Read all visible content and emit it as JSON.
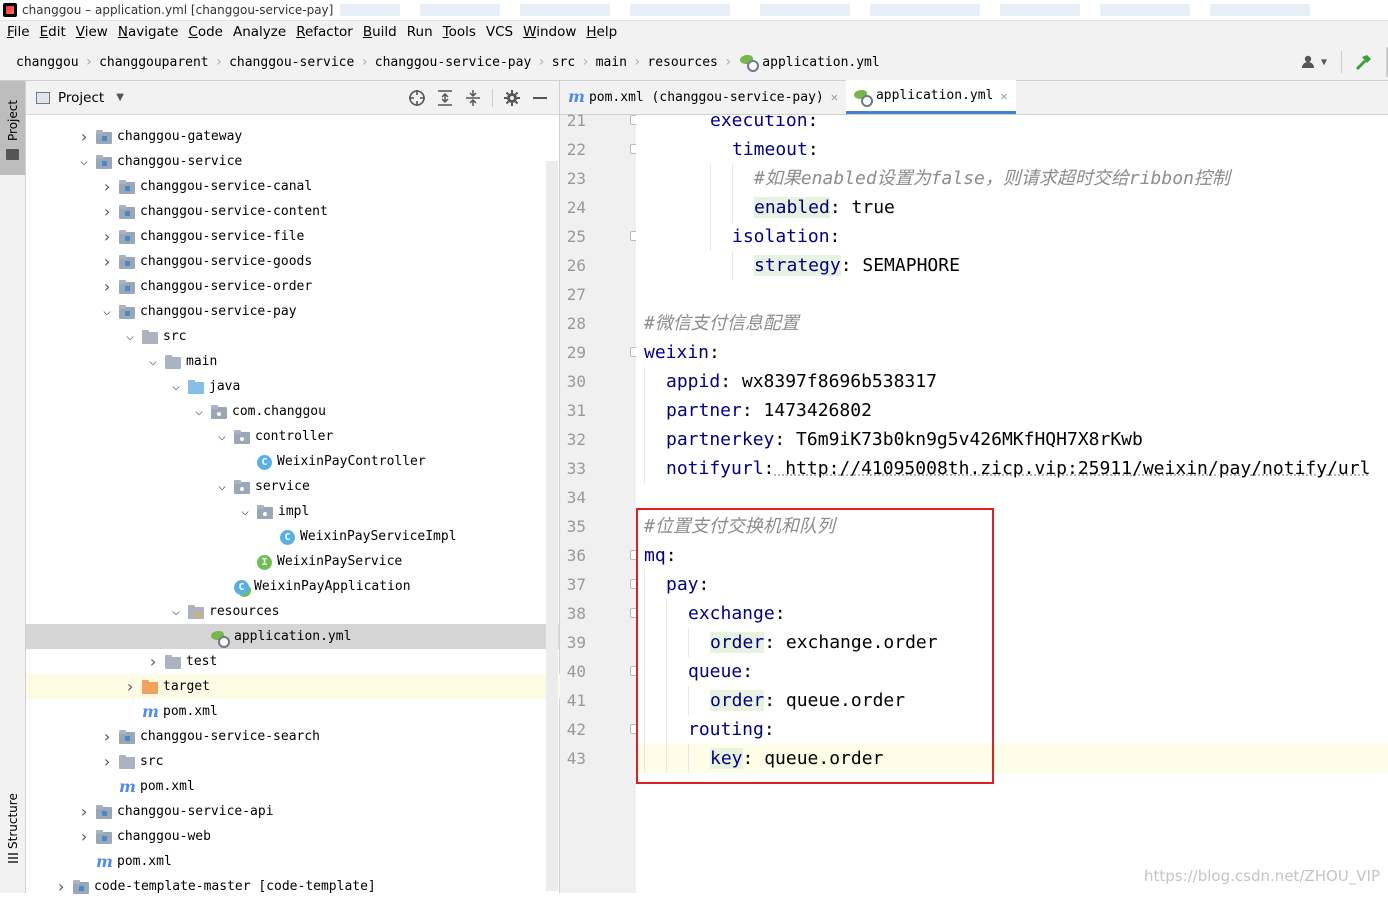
{
  "window": {
    "title": "changgou – application.yml [changgou-service-pay]"
  },
  "menu": [
    {
      "label": "File",
      "u": "F",
      "rest": "ile"
    },
    {
      "label": "Edit",
      "u": "E",
      "rest": "dit"
    },
    {
      "label": "View",
      "u": "V",
      "rest": "iew"
    },
    {
      "label": "Navigate",
      "u": "N",
      "rest": "avigate"
    },
    {
      "label": "Code",
      "u": "C",
      "rest": "ode"
    },
    {
      "label": "Analyze",
      "u": "",
      "rest": "Analyze"
    },
    {
      "label": "Refactor",
      "u": "R",
      "rest": "efactor"
    },
    {
      "label": "Build",
      "u": "B",
      "rest": "uild"
    },
    {
      "label": "Run",
      "u": "",
      "rest": "Run"
    },
    {
      "label": "Tools",
      "u": "T",
      "rest": "ools"
    },
    {
      "label": "VCS",
      "u": "",
      "rest": "VCS"
    },
    {
      "label": "Window",
      "u": "W",
      "rest": "indow"
    },
    {
      "label": "Help",
      "u": "H",
      "rest": "elp"
    }
  ],
  "breadcrumbs": [
    "changgou",
    "changgouparent",
    "changgou-service",
    "changgou-service-pay",
    "src",
    "main",
    "resources",
    "application.yml"
  ],
  "project_panel": {
    "title": "Project",
    "tree": [
      {
        "label": "changgou-gateway",
        "depth": 2,
        "arrow": "›",
        "icon": "module-folder",
        "bold": false
      },
      {
        "label": "changgou-service",
        "depth": 2,
        "arrow": "⌄",
        "icon": "module-folder"
      },
      {
        "label": "changgou-service-canal",
        "depth": 3,
        "arrow": "›",
        "icon": "module-folder"
      },
      {
        "label": "changgou-service-content",
        "depth": 3,
        "arrow": "›",
        "icon": "module-folder"
      },
      {
        "label": "changgou-service-file",
        "depth": 3,
        "arrow": "›",
        "icon": "module-folder"
      },
      {
        "label": "changgou-service-goods",
        "depth": 3,
        "arrow": "›",
        "icon": "module-folder"
      },
      {
        "label": "changgou-service-order",
        "depth": 3,
        "arrow": "›",
        "icon": "module-folder"
      },
      {
        "label": "changgou-service-pay",
        "depth": 3,
        "arrow": "⌄",
        "icon": "module-folder"
      },
      {
        "label": "src",
        "depth": 4,
        "arrow": "⌄",
        "icon": "folder"
      },
      {
        "label": "main",
        "depth": 5,
        "arrow": "⌄",
        "icon": "folder"
      },
      {
        "label": "java",
        "depth": 6,
        "arrow": "⌄",
        "icon": "source-folder"
      },
      {
        "label": "com.changgou",
        "depth": 7,
        "arrow": "⌄",
        "icon": "package"
      },
      {
        "label": "controller",
        "depth": 8,
        "arrow": "⌄",
        "icon": "package"
      },
      {
        "label": "WeixinPayController",
        "depth": 9,
        "arrow": "",
        "icon": "class"
      },
      {
        "label": "service",
        "depth": 8,
        "arrow": "⌄",
        "icon": "package"
      },
      {
        "label": "impl",
        "depth": 9,
        "arrow": "⌄",
        "icon": "package"
      },
      {
        "label": "WeixinPayServiceImpl",
        "depth": 10,
        "arrow": "",
        "icon": "class"
      },
      {
        "label": "WeixinPayService",
        "depth": 9,
        "arrow": "",
        "icon": "interface"
      },
      {
        "label": "WeixinPayApplication",
        "depth": 8,
        "arrow": "",
        "icon": "spring-class"
      },
      {
        "label": "resources",
        "depth": 6,
        "arrow": "⌄",
        "icon": "resources-folder"
      },
      {
        "label": "application.yml",
        "depth": 7,
        "arrow": "",
        "icon": "yml-file",
        "selected": true
      },
      {
        "label": "test",
        "depth": 5,
        "arrow": "›",
        "icon": "folder"
      },
      {
        "label": "target",
        "depth": 4,
        "arrow": "›",
        "icon": "excluded-folder",
        "highlight": true
      },
      {
        "label": "pom.xml",
        "depth": 4,
        "arrow": "",
        "icon": "maven-file"
      },
      {
        "label": "changgou-service-search",
        "depth": 3,
        "arrow": "›",
        "icon": "module-folder"
      },
      {
        "label": "src",
        "depth": 3,
        "arrow": "›",
        "icon": "folder"
      },
      {
        "label": "pom.xml",
        "depth": 3,
        "arrow": "",
        "icon": "maven-file"
      },
      {
        "label": "changgou-service-api",
        "depth": 2,
        "arrow": "›",
        "icon": "module-folder"
      },
      {
        "label": "changgou-web",
        "depth": 2,
        "arrow": "›",
        "icon": "module-folder"
      },
      {
        "label": "pom.xml",
        "depth": 2,
        "arrow": "",
        "icon": "maven-file"
      },
      {
        "label": "code-template-master [code-template]",
        "depth": 1,
        "arrow": "›",
        "icon": "module-folder"
      }
    ]
  },
  "side_tabs": {
    "project": "Project",
    "structure": "Structure"
  },
  "editor": {
    "tabs": [
      {
        "label": "pom.xml (changgou-service-pay)",
        "icon": "maven-file",
        "active": false
      },
      {
        "label": "application.yml",
        "icon": "yml-file",
        "active": true
      }
    ],
    "lines": [
      {
        "n": "21",
        "indent": 3,
        "key": "execution",
        "sep": ":",
        "value": "",
        "type": "kv"
      },
      {
        "n": "22",
        "indent": 4,
        "key": "timeout",
        "sep": ":",
        "value": "",
        "type": "kv"
      },
      {
        "n": "23",
        "indent": 5,
        "text": "#如果enabled设置为false，则请求超时交给ribbon控制",
        "type": "comment"
      },
      {
        "n": "24",
        "indent": 5,
        "key": "enabled",
        "sep": ":",
        "value": " true",
        "type": "kv",
        "keybg": true
      },
      {
        "n": "25",
        "indent": 4,
        "key": "isolation",
        "sep": ":",
        "value": "",
        "type": "kv"
      },
      {
        "n": "26",
        "indent": 5,
        "key": "strategy",
        "sep": ":",
        "value": " SEMAPHORE",
        "type": "kv",
        "keybg": true
      },
      {
        "n": "27",
        "indent": 0,
        "type": "empty"
      },
      {
        "n": "28",
        "indent": 0,
        "text": "#微信支付信息配置",
        "type": "comment"
      },
      {
        "n": "29",
        "indent": 0,
        "key": "weixin",
        "sep": ":",
        "value": "",
        "type": "kv"
      },
      {
        "n": "30",
        "indent": 1,
        "key": "appid",
        "sep": ":",
        "value": " wx8397f8696b538317",
        "type": "kv"
      },
      {
        "n": "31",
        "indent": 1,
        "key": "partner",
        "sep": ":",
        "value": " 1473426802",
        "type": "kv"
      },
      {
        "n": "32",
        "indent": 1,
        "key": "partnerkey",
        "sep": ":",
        "value": " T6m9iK73b0kn9g5v426MKfHQH7X8rKwb",
        "type": "kv"
      },
      {
        "n": "33",
        "indent": 1,
        "key": "notifyurl",
        "sep": ":",
        "value": " http://41095008th.zicp.vip:25911/weixin/pay/notify/url",
        "type": "kv"
      },
      {
        "n": "34",
        "indent": 0,
        "type": "empty"
      },
      {
        "n": "35",
        "indent": 0,
        "text": "#位置支付交换机和队列",
        "type": "comment"
      },
      {
        "n": "36",
        "indent": 0,
        "key": "mq",
        "sep": ":",
        "value": "",
        "type": "kv"
      },
      {
        "n": "37",
        "indent": 1,
        "key": "pay",
        "sep": ":",
        "value": "",
        "type": "kv"
      },
      {
        "n": "38",
        "indent": 2,
        "key": "exchange",
        "sep": ":",
        "value": "",
        "type": "kv"
      },
      {
        "n": "39",
        "indent": 3,
        "key": "order",
        "sep": ":",
        "value": " exchange.order",
        "type": "kv",
        "keybg": true
      },
      {
        "n": "40",
        "indent": 2,
        "key": "queue",
        "sep": ":",
        "value": "",
        "type": "kv"
      },
      {
        "n": "41",
        "indent": 3,
        "key": "order",
        "sep": ":",
        "value": " queue.order",
        "type": "kv",
        "keybg": true
      },
      {
        "n": "42",
        "indent": 2,
        "key": "routing",
        "sep": ":",
        "value": "",
        "type": "kv"
      },
      {
        "n": "43",
        "indent": 3,
        "key": "key",
        "sep": ":",
        "value": " queue.order",
        "type": "kv",
        "keybg": true,
        "current": true
      }
    ]
  },
  "watermark": "https://blog.csdn.net/ZHOU_VIP",
  "colors": {
    "key": "#000080",
    "comment": "#8c8c8c",
    "annotation_box": "#e02020",
    "accent": "#4083c9"
  }
}
